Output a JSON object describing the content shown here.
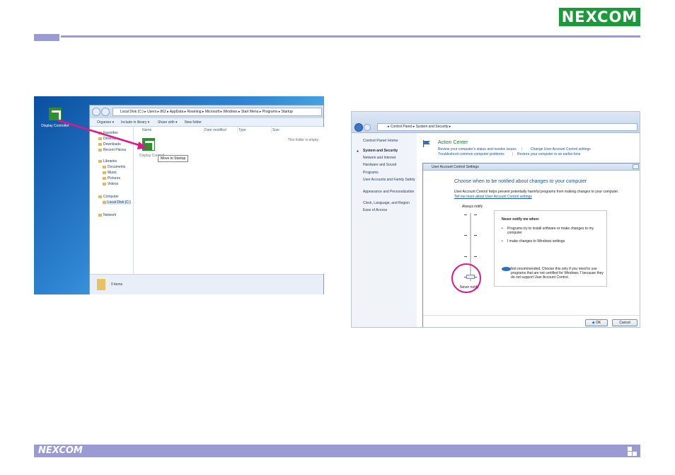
{
  "brand": {
    "logo_top": "NEXCOM",
    "logo_footer": "NEXCOM",
    "accent": "#9b9bd3",
    "logo_green": "#1c9a3b",
    "highlight": "#e0168a"
  },
  "left_screenshot": {
    "desktop_icon_label": "Display Controller",
    "address_path": "Local Disk (C:) ▸ Users ▸ 862 ▸ AppData ▸ Roaming ▸ Microsoft ▸ Windows ▸ Start Menu ▸ Programs ▸ Startup",
    "toolbar": [
      "Organize ▾",
      "Include in library ▾",
      "Share with ▾",
      "New folder"
    ],
    "sidebar": {
      "favorites_header": "Favorites",
      "favorites": [
        "Desktop",
        "Downloads",
        "Recent Places"
      ],
      "libraries_header": "Libraries",
      "libraries": [
        "Documents",
        "Music",
        "Pictures",
        "Videos"
      ],
      "computer_header": "Computer",
      "computer": [
        "Local Disk (C:)"
      ],
      "network": "Network"
    },
    "columns": [
      "Name",
      "Date modified",
      "Type",
      "Size"
    ],
    "empty_message": "This folder is empty.",
    "dragged_label": "Display Controll",
    "tooltip": "Move to Startup",
    "status": "0 items"
  },
  "right_screenshot": {
    "address_path": "▸ Control Panel ▸ System and Security ▸",
    "sidebar": {
      "home": "Control Panel Home",
      "items": [
        "System and Security",
        "Network and Internet",
        "Hardware and Sound",
        "Programs",
        "User Accounts and Family Safety",
        "Appearance and Personalization",
        "Clock, Language, and Region",
        "Ease of Access"
      ]
    },
    "action_center": {
      "title": "Action Center",
      "link1": "Review your computer's status and resolve issues",
      "link2": "Change User Account Control settings",
      "link3": "Troubleshoot common computer problems",
      "link4": "Restore your computer to an earlier time",
      "separator": "|"
    },
    "uac": {
      "window_title": "User Account Control Settings",
      "heading": "Choose when to be notified about changes to your computer",
      "description": "User Account Control helps prevent potentially harmful programs from making changes to your computer.",
      "more_link": "Tell me more about User Account Control settings",
      "always_label": "Always notify",
      "never_label": "Never notify",
      "slider_level": 0,
      "slider_levels_total": 4,
      "box_title": "Never notify me when:",
      "box_items": [
        "Programs try to install software or make changes to my computer",
        "I make changes to Windows settings"
      ],
      "box_note": "Not recommended. Choose this only if you need to use programs that are not certified for Windows 7 because they do not support User Account Control.",
      "ok_label": "OK",
      "cancel_label": "Cancel"
    }
  }
}
